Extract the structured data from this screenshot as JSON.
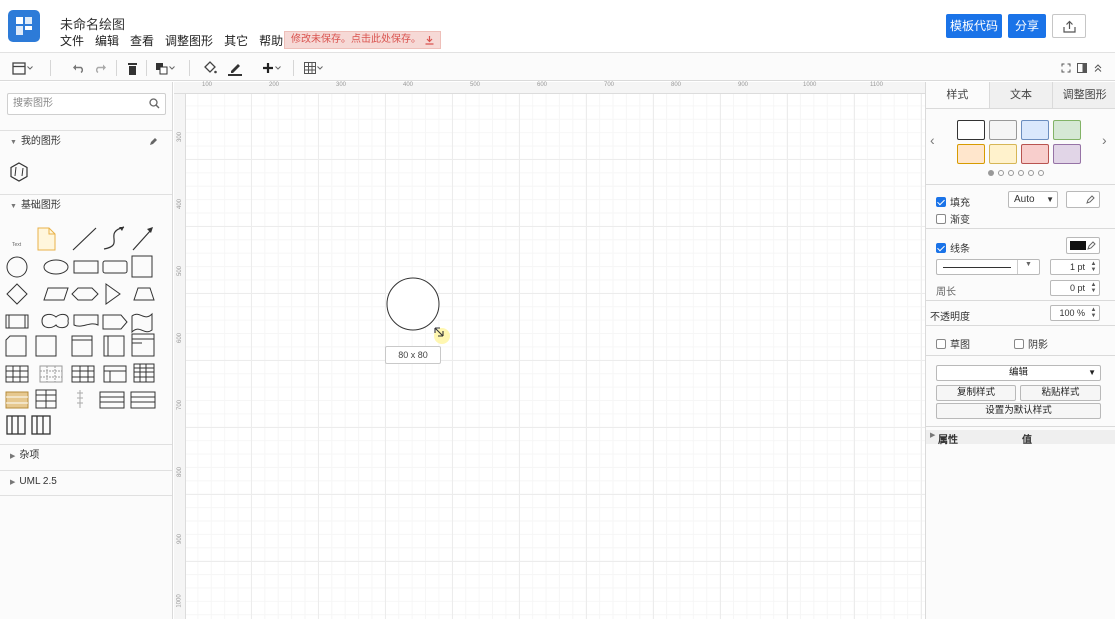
{
  "header": {
    "title": "未命名绘图",
    "menu": [
      "文件",
      "编辑",
      "查看",
      "调整图形",
      "其它",
      "帮助"
    ],
    "save_notice": "修改未保存。点击此处保存。",
    "template_code_label": "模板代码",
    "share_label": "分享"
  },
  "sidebar": {
    "search_placeholder": "搜索图形",
    "sections": {
      "my_shapes": "我的图形",
      "basic_shapes": "基础图形",
      "misc": "杂项",
      "uml": "UML 2.5"
    },
    "text_shape_label": "Text"
  },
  "ruler": {
    "top": [
      "100",
      "200",
      "300",
      "400",
      "500",
      "600",
      "700",
      "800",
      "900",
      "1000",
      "1100"
    ],
    "left": [
      "300",
      "400",
      "500",
      "600",
      "700",
      "800",
      "900",
      "1000"
    ]
  },
  "canvas": {
    "size_label": "80 x 80"
  },
  "panel": {
    "tabs": [
      "样式",
      "文本",
      "调整图形"
    ],
    "fill_label": "填充",
    "fill_value": "Auto",
    "gradient_label": "渐变",
    "line_label": "线条",
    "line_width": "1 pt",
    "perimeter_label": "周长",
    "perimeter_value": "0 pt",
    "opacity_label": "不透明度",
    "opacity_value": "100 %",
    "sketch_label": "草图",
    "shadow_label": "阴影",
    "edit_label": "编辑",
    "copy_style_label": "复制样式",
    "paste_style_label": "粘贴样式",
    "set_default_label": "设置为默认样式",
    "property_header": "属性",
    "value_header": "值"
  },
  "colors": {
    "accent": "#1a73e8",
    "swatches": [
      "#ffffff",
      "#f5f5f5",
      "#dae8fc",
      "#d5e8d4",
      "#ffe6cc",
      "#fff2cc",
      "#f8cecc",
      "#e1d5e7"
    ]
  }
}
